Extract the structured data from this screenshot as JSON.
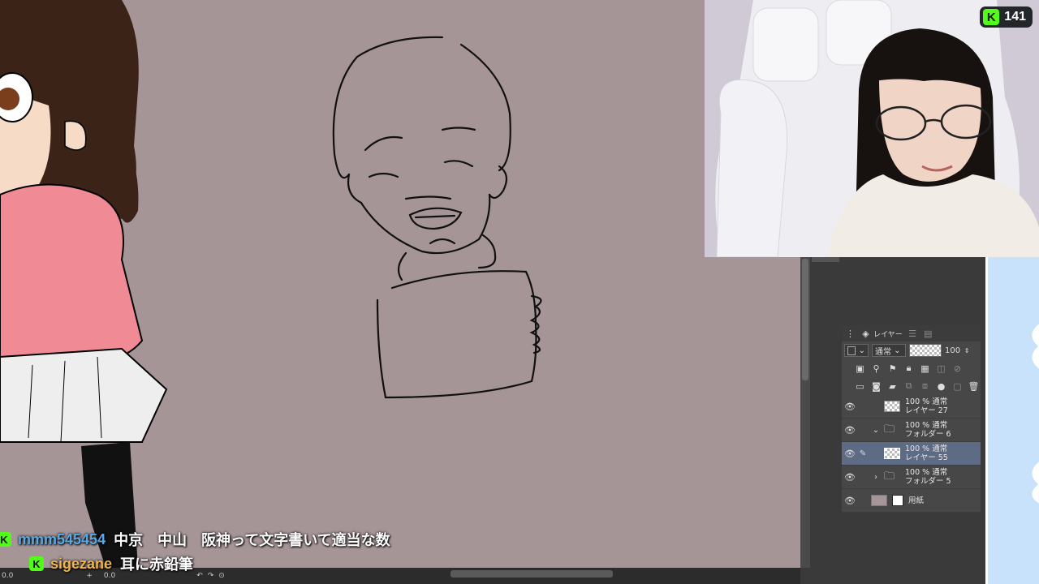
{
  "stream": {
    "viewer_count": "141",
    "platform_icon": "kick-logo"
  },
  "colors": {
    "canvas_bg": "#a69597",
    "kick_green": "#53fc18",
    "selected_layer": "#5e6b84"
  },
  "layer_panel": {
    "tab_label": "レイヤー",
    "blend_mode": "通常",
    "opacity": "100",
    "layers": [
      {
        "line1": "100 % 通常",
        "line2": "レイヤー 27",
        "type": "layer",
        "selected": false
      },
      {
        "line1": "100 % 通常",
        "line2": "フォルダー 6",
        "type": "folder-open",
        "selected": false
      },
      {
        "line1": "100 % 通常",
        "line2": "レイヤー 55",
        "type": "layer",
        "selected": true
      },
      {
        "line1": "100 % 通常",
        "line2": "フォルダー 5",
        "type": "folder-closed",
        "selected": false
      },
      {
        "line1": "用紙",
        "line2": "",
        "type": "paper",
        "selected": false
      }
    ]
  },
  "chat": [
    {
      "user": "mmm545454",
      "user_color": "#5aa9e6",
      "message": "中京　中山　阪神って文字書いて適当な数"
    },
    {
      "user": "sigezane",
      "user_color": "#f0b64a",
      "message": "耳に赤鉛筆"
    }
  ],
  "bottom_bar": {
    "zoom_left": "0.0",
    "zoom_mid": "0.0"
  }
}
